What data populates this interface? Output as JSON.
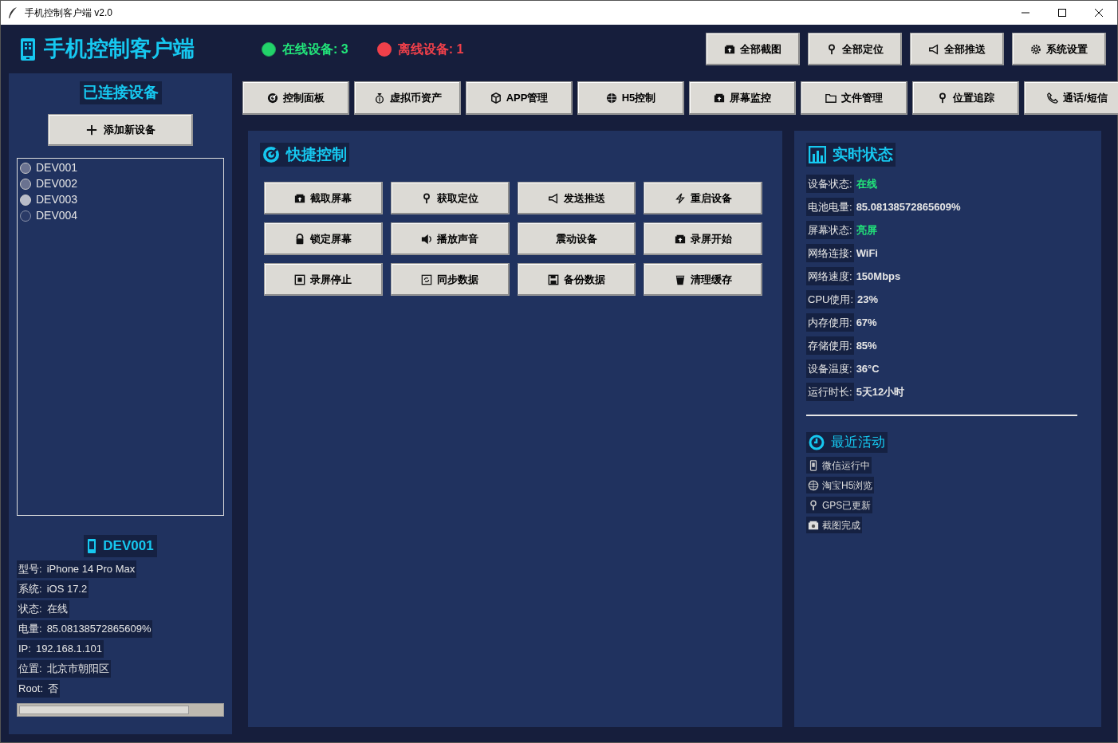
{
  "window": {
    "title": "手机控制客户端 v2.0"
  },
  "header": {
    "title": "手机控制客户端",
    "online": "在线设备: 3",
    "offline": "离线设备: 1",
    "buttons": [
      "全部截图",
      "全部定位",
      "全部推送",
      "系统设置"
    ]
  },
  "sidebar": {
    "title": "已连接设备",
    "add_button": "添加新设备",
    "devices": [
      {
        "name": "DEV001",
        "selected": false,
        "online": true
      },
      {
        "name": "DEV002",
        "selected": false,
        "online": true
      },
      {
        "name": "DEV003",
        "selected": true,
        "online": true
      },
      {
        "name": "DEV004",
        "selected": false,
        "online": false
      }
    ],
    "detail": {
      "title": "DEV001",
      "rows": [
        {
          "label": "型号:",
          "value": "iPhone 14 Pro Max"
        },
        {
          "label": "系统:",
          "value": "iOS 17.2"
        },
        {
          "label": "状态:",
          "value": "在线"
        },
        {
          "label": "电量:",
          "value": "85.08138572865609%"
        },
        {
          "label": "IP:",
          "value": "192.168.1.101"
        },
        {
          "label": "位置:",
          "value": "北京市朝阳区"
        },
        {
          "label": "Root:",
          "value": "否"
        }
      ],
      "battery": {
        "level": 0.84
      }
    }
  },
  "tabs": [
    {
      "label": "控制面板"
    },
    {
      "label": "虚拟币资产"
    },
    {
      "label": "APP管理"
    },
    {
      "label": "H5控制"
    },
    {
      "label": "屏幕监控"
    },
    {
      "label": "文件管理"
    },
    {
      "label": "位置追踪"
    },
    {
      "label": "通话/短信"
    }
  ],
  "quick_control": {
    "title": "快捷控制",
    "buttons": [
      "截取屏幕",
      "获取定位",
      "发送推送",
      "重启设备",
      "锁定屏幕",
      "播放声音",
      "震动设备",
      "录屏开始",
      "录屏停止",
      "同步数据",
      "备份数据",
      "清理缓存"
    ]
  },
  "status": {
    "title": "实时状态",
    "rows": [
      {
        "label": "设备状态:",
        "value": "在线",
        "color": "#22e57a"
      },
      {
        "label": "电池电量:",
        "value": "85.08138572865609%",
        "color": "#e6e6e6"
      },
      {
        "label": "屏幕状态:",
        "value": "亮屏",
        "color": "#22e57a"
      },
      {
        "label": "网络连接:",
        "value": "WiFi",
        "color": "#e6e6e6"
      },
      {
        "label": "网络速度:",
        "value": "150Mbps",
        "color": "#e6e6e6"
      },
      {
        "label": "CPU使用:",
        "value": "23%",
        "color": "#e6e6e6"
      },
      {
        "label": "内存使用:",
        "value": "67%",
        "color": "#e6e6e6"
      },
      {
        "label": "存储使用:",
        "value": "85%",
        "color": "#e6e6e6"
      },
      {
        "label": "设备温度:",
        "value": "36°C",
        "color": "#e6e6e6"
      },
      {
        "label": "运行时长:",
        "value": "5天12小时",
        "color": "#e6e6e6"
      }
    ]
  },
  "activity": {
    "title": "最近活动",
    "items": [
      "微信运行中",
      "淘宝H5浏览",
      "GPS已更新",
      "截图完成"
    ]
  }
}
